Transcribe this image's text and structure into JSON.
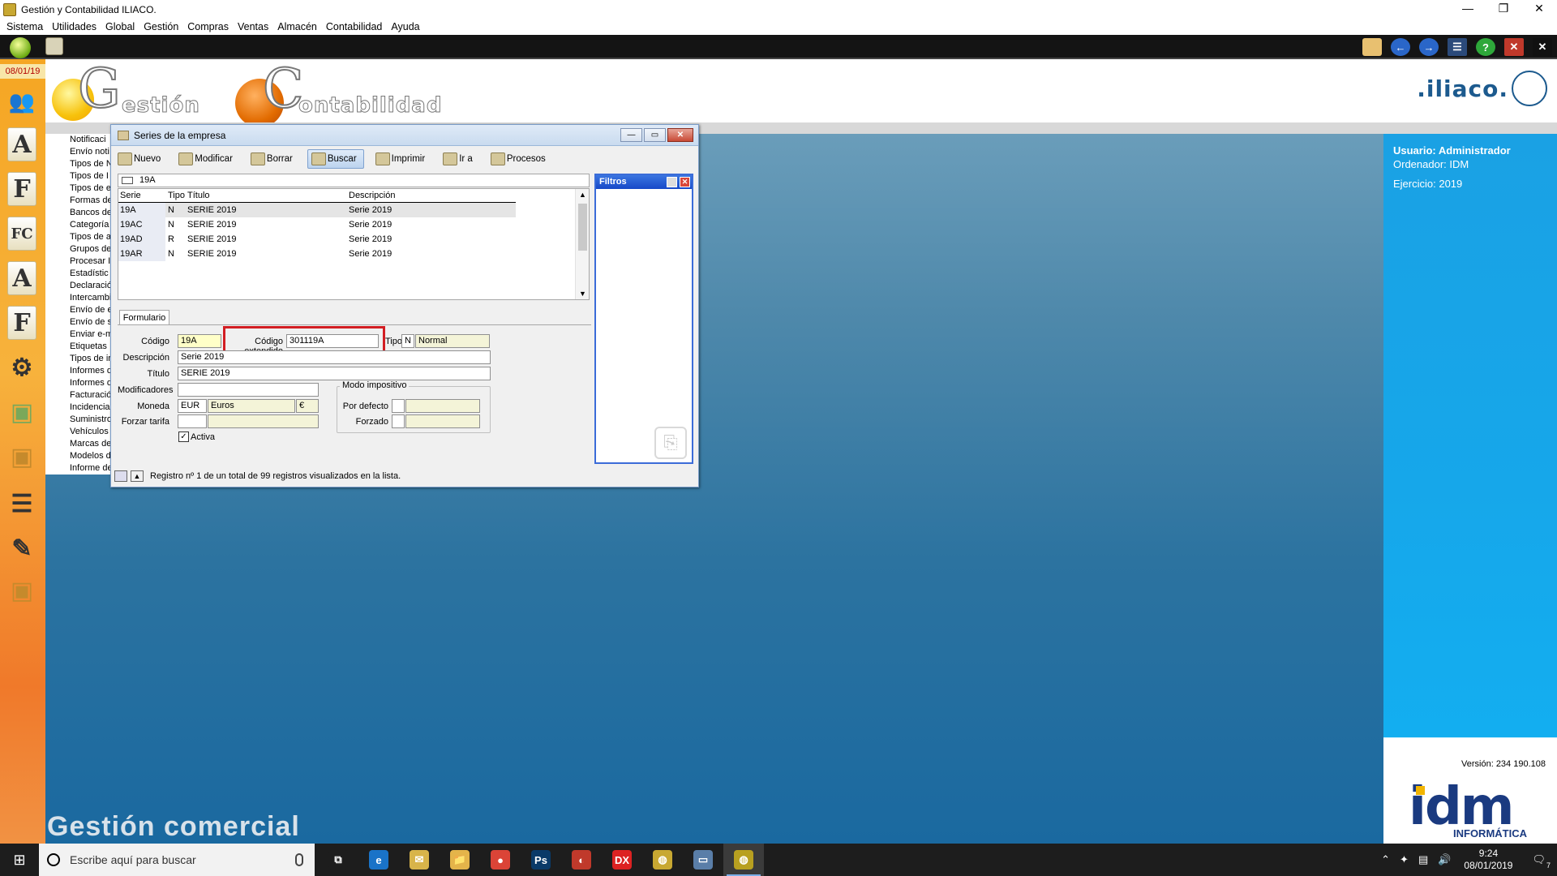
{
  "window": {
    "title": "Gestión y Contabilidad ILIACO.",
    "controls": [
      "—",
      "❐",
      "✕"
    ]
  },
  "menu": [
    "Sistema",
    "Utilidades",
    "Global",
    "Gestión",
    "Compras",
    "Ventas",
    "Almacén",
    "Contabilidad",
    "Ayuda"
  ],
  "sidebar": {
    "date": "08/01/19",
    "icons": [
      "users-icon",
      "A",
      "F",
      "FC",
      "A",
      "F",
      "gear-icon",
      "bag-icon",
      "bag-icon",
      "list-icon",
      "pen-icon",
      "bag-icon"
    ]
  },
  "banner": {
    "logo1_big": "G",
    "logo1_rest": "estión",
    "logo2_big": "C",
    "logo2_rest": "ontabilidad",
    "brand": ".iliaco."
  },
  "list_items": [
    "Notificaci",
    "Envío noti",
    "Tipos de N",
    "Tipos de I",
    "Tipos de e",
    "Formas de",
    "Bancos de",
    "Categoría",
    "Tipos de a",
    "Grupos de",
    "Procesar I",
    "Estadístic",
    "Declaració",
    "Intercambi",
    "Envío de e",
    "Envío de s",
    "Enviar e-m",
    "Etiquetas",
    "Tipos de in",
    "Informes d",
    "Informes d",
    "Facturació",
    "Incidencia",
    "Suministro",
    "Vehículos",
    "Marcas de",
    "Modelos d",
    "Informe de"
  ],
  "dialog": {
    "title": "Series de la empresa",
    "toolbar": [
      {
        "label": "Nuevo",
        "icon": "new-icon"
      },
      {
        "label": "Modificar",
        "icon": "edit-icon"
      },
      {
        "label": "Borrar",
        "icon": "delete-icon"
      },
      {
        "label": "Buscar",
        "icon": "search-icon"
      },
      {
        "label": "Imprimir",
        "icon": "print-icon"
      },
      {
        "label": "Ir a",
        "icon": "goto-icon"
      },
      {
        "label": "Procesos",
        "icon": "process-icon"
      }
    ],
    "search_value": "19A",
    "grid": {
      "headers": [
        "Serie",
        "Tipo",
        "Título",
        "Descripción"
      ],
      "rows": [
        [
          "19A",
          "N",
          "SERIE 2019",
          "Serie 2019"
        ],
        [
          "19AC",
          "N",
          "SERIE 2019",
          "Serie 2019"
        ],
        [
          "19AD",
          "R",
          "SERIE 2019",
          "Serie 2019"
        ],
        [
          "19AR",
          "N",
          "SERIE 2019",
          "Serie 2019"
        ]
      ]
    },
    "filters_title": "Filtros",
    "form": {
      "tab": "Formulario",
      "codigo_label": "Código",
      "codigo": "19A",
      "codigo_ext_label": "Código extendido",
      "codigo_ext": "301119A",
      "tipo_label": "Tipo",
      "tipo_code": "N",
      "tipo_name": "Normal",
      "descripcion_label": "Descripción",
      "descripcion": "Serie 2019",
      "titulo_label": "Título",
      "titulo": "SERIE 2019",
      "modificadores_label": "Modificadores",
      "modificadores": "",
      "moneda_label": "Moneda",
      "moneda_code": "EUR",
      "moneda_name": "Euros",
      "moneda_symbol": "€",
      "forzar_label": "Forzar tarifa",
      "activa_label": "Activa",
      "activa_checked": true,
      "modo_label": "Modo impositivo",
      "por_defecto_label": "Por defecto",
      "forzado_label": "Forzado"
    },
    "status": "Registro nº 1 de un total de 99 registros visualizados en la lista."
  },
  "right_panel": {
    "usuario": "Usuario: Administrador",
    "ordenador": "Ordenador: IDM",
    "ejercicio": "Ejercicio: 2019",
    "version": "Versión: 234 190.108",
    "idm": "idm",
    "idm_sub": "INFORMÁTICA"
  },
  "footer_text": "Gestión comercial",
  "taskbar": {
    "search_placeholder": "Escribe aquí para buscar",
    "time": "9:24",
    "date": "08/01/2019",
    "notif_count": "7",
    "apps": [
      {
        "name": "task-view-icon",
        "label": "⧉",
        "color": "#1d1d1d"
      },
      {
        "name": "edge-icon",
        "label": "e",
        "color": "#1a73c8"
      },
      {
        "name": "mail-icon",
        "label": "✉",
        "color": "#d8b44a"
      },
      {
        "name": "explorer-icon",
        "label": "📁",
        "color": "#e4b44a"
      },
      {
        "name": "chrome-icon",
        "label": "●",
        "color": "#db4437"
      },
      {
        "name": "photoshop-icon",
        "label": "Ps",
        "color": "#0a3a68"
      },
      {
        "name": "app-icon",
        "label": "◐",
        "color": "#c0392b"
      },
      {
        "name": "dx-icon",
        "label": "DX",
        "color": "#d22"
      },
      {
        "name": "iliaco-icon",
        "label": "◍",
        "color": "#c8a832"
      },
      {
        "name": "window-icon",
        "label": "▭",
        "color": "#5a7ea8"
      },
      {
        "name": "iliaco-active-icon",
        "label": "◍",
        "color": "#b8a020"
      }
    ]
  }
}
